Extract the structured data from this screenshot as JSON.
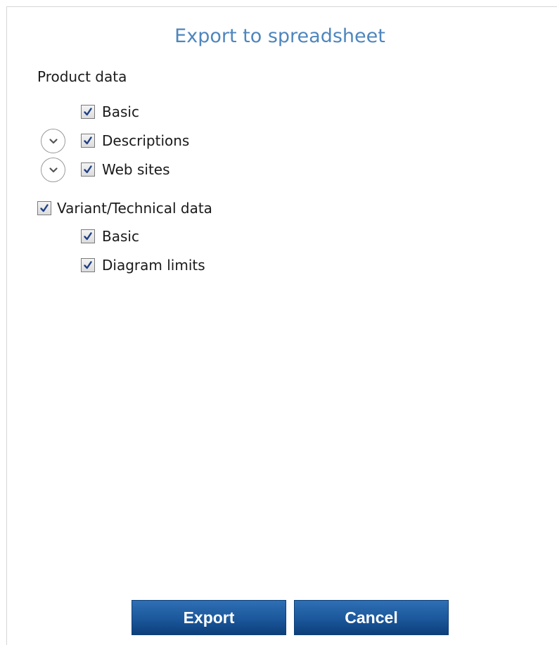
{
  "dialog": {
    "title": "Export to spreadsheet"
  },
  "product_data": {
    "label": "Product data",
    "options": [
      {
        "label": "Basic",
        "checked": true,
        "expandable": false
      },
      {
        "label": "Descriptions",
        "checked": true,
        "expandable": true
      },
      {
        "label": "Web sites",
        "checked": true,
        "expandable": true
      }
    ]
  },
  "variant_data": {
    "label": "Variant/Technical data",
    "checked": true,
    "options": [
      {
        "label": "Basic",
        "checked": true
      },
      {
        "label": "Diagram limits",
        "checked": true
      }
    ]
  },
  "buttons": {
    "export_label": "Export",
    "cancel_label": "Cancel"
  },
  "colors": {
    "title": "#4f86bd",
    "button_top": "#2f6fb4",
    "button_bottom": "#0d3f7a",
    "checkmark": "#1f3f86"
  },
  "icons": {
    "expander": "chevron-down-icon",
    "checkbox": "checkmark-icon"
  }
}
